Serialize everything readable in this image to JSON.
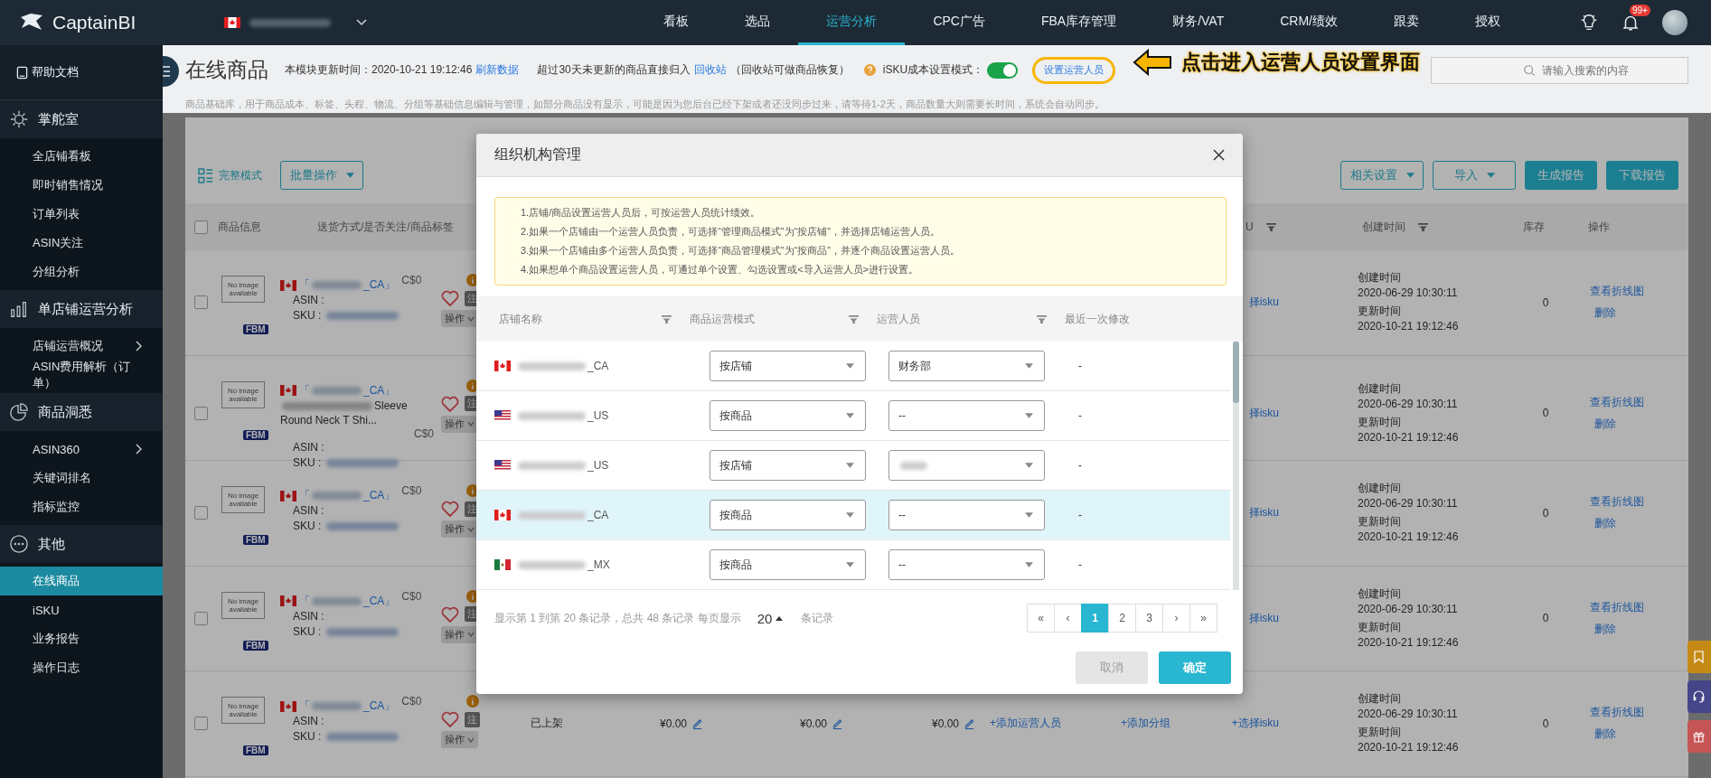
{
  "brand": {
    "name": "CaptainBI"
  },
  "nav": [
    {
      "label": "看板",
      "selected": false
    },
    {
      "label": "选品",
      "selected": false
    },
    {
      "label": "运营分析",
      "selected": true
    },
    {
      "label": "CPC广告",
      "selected": false
    },
    {
      "label": "FBA库存管理",
      "selected": false
    },
    {
      "label": "财务/VAT",
      "selected": false
    },
    {
      "label": "CRM/绩效",
      "selected": false
    },
    {
      "label": "跟卖",
      "selected": false
    },
    {
      "label": "授权",
      "selected": false
    }
  ],
  "notifications": {
    "badge": "99+"
  },
  "sidebar": {
    "help": "帮助文档",
    "sections": [
      {
        "label": "掌舵室",
        "items": [
          {
            "label": "全店铺看板",
            "selected": false,
            "expandable": false
          },
          {
            "label": "即时销售情况",
            "selected": false,
            "expandable": false
          },
          {
            "label": "订单列表",
            "selected": false,
            "expandable": false
          },
          {
            "label": "ASIN关注",
            "selected": false,
            "expandable": false
          },
          {
            "label": "分组分析",
            "selected": false,
            "expandable": false
          }
        ]
      },
      {
        "label": "单店铺运营分析",
        "items": [
          {
            "label": "店铺运营概况",
            "selected": false,
            "expandable": true
          },
          {
            "label": "ASIN费用解析（订单）",
            "selected": false,
            "expandable": false
          }
        ]
      },
      {
        "label": "商品洞悉",
        "items": [
          {
            "label": "ASIN360",
            "selected": false,
            "expandable": true
          },
          {
            "label": "关键词排名",
            "selected": false,
            "expandable": false
          },
          {
            "label": "指标监控",
            "selected": false,
            "expandable": false
          }
        ]
      },
      {
        "label": "其他",
        "items": [
          {
            "label": "在线商品",
            "selected": true,
            "expandable": false
          },
          {
            "label": "iSKU",
            "selected": false,
            "expandable": false
          },
          {
            "label": "业务报告",
            "selected": false,
            "expandable": false
          },
          {
            "label": "操作日志",
            "selected": false,
            "expandable": false
          }
        ]
      }
    ]
  },
  "page": {
    "title": "在线商品",
    "update_label": "本模块更新时间：2020-10-21 19:12:46",
    "refresh_link": "刷新数据",
    "recycle_note": "超过30天未更新的商品直接归入",
    "recycle_link": "回收站",
    "recycle_hint": "（回收站可做商品恢复）",
    "isku_mode_label": "iSKU成本设置模式：",
    "isku_mode_on": true,
    "operator_button": "设置运营人员",
    "operator_button_highlighted": true,
    "search_placeholder": "请输入搜索的内容",
    "description": "商品基础库，用于商品成本、标签、头程、物流、分组等基础信息编辑与管理，如部分商品没有显示，可能是因为您后台已经下架或者还没同步过来，请等待1-2天，商品数量大则需要长时间，系统会自动同步。"
  },
  "annotation": {
    "text": "点击进入运营人员设置界面"
  },
  "toolbar": {
    "view_mode": "完整模式",
    "batch": "批量操作",
    "right_buttons": [
      {
        "label": "相关设置",
        "kind": "dropdown"
      },
      {
        "label": "导入",
        "kind": "dropdown"
      },
      {
        "label": "生成报告",
        "kind": "primary"
      },
      {
        "label": "下载报告",
        "kind": "primary"
      }
    ]
  },
  "table": {
    "select_all_checked": false,
    "left_columns": [
      {
        "label": "商品信息"
      },
      {
        "label": "送货方式/是否关注/商品标签"
      }
    ],
    "right_columns": [
      {
        "label": "U"
      },
      {
        "label": "创建时间"
      },
      {
        "label": "库存"
      },
      {
        "label": "操作"
      }
    ],
    "rows": [
      {
        "checked": false,
        "image_text": "No image available",
        "kind": "ca",
        "store": [
          "「",
          "_CA」"
        ],
        "price": "C$0",
        "asin_label": "ASIN :",
        "sku_label": "SKU :",
        "fulfillment": "FBM",
        "favorite": false,
        "tag": "注",
        "menu": "操作",
        "isku": "择isku",
        "created_label": "创建时间",
        "created": "2020-06-29 10:30:11",
        "updated_label": "更新时间",
        "updated": "2020-10-21 19:12:46",
        "stock": "0",
        "actions": [
          "查看折线图",
          "删除"
        ]
      },
      {
        "checked": false,
        "image_text": "No image available",
        "kind": "ca",
        "store": [
          "「",
          "_CA」"
        ],
        "title": "Sleeve Round Neck T Shi...",
        "price": "C$0",
        "asin_label": "ASIN :",
        "sku_label": "SKU :",
        "fulfillment": "FBM",
        "favorite": false,
        "tag": "注",
        "menu": "操作",
        "isku": "择isku",
        "created_label": "创建时间",
        "created": "2020-06-29 10:30:11",
        "updated_label": "更新时间",
        "updated": "2020-10-21 19:12:46",
        "stock": "0",
        "actions": [
          "查看折线图",
          "删除"
        ]
      },
      {
        "checked": false,
        "image_text": "No image available",
        "kind": "ca",
        "store": [
          "「",
          "_CA」"
        ],
        "price": "C$0",
        "asin_label": "ASIN :",
        "sku_label": "SKU :",
        "fulfillment": "FBM",
        "favorite": false,
        "tag": "注",
        "menu": "操作",
        "isku": "择isku",
        "created_label": "创建时间",
        "created": "2020-06-29 10:30:11",
        "updated_label": "更新时间",
        "updated": "2020-10-21 19:12:46",
        "stock": "0",
        "actions": [
          "查看折线图",
          "删除"
        ]
      },
      {
        "checked": false,
        "image_text": "No image available",
        "kind": "ca",
        "store": [
          "「",
          "_CA」"
        ],
        "price": "C$0",
        "asin_label": "ASIN :",
        "sku_label": "SKU :",
        "fulfillment": "FBM",
        "favorite": false,
        "tag": "注",
        "menu": "操作",
        "isku": "择isku",
        "created_label": "创建时间",
        "created": "2020-06-29 10:30:11",
        "updated_label": "更新时间",
        "updated": "2020-10-21 19:12:46",
        "stock": "0",
        "actions": [
          "查看折线图",
          "删除"
        ]
      },
      {
        "checked": false,
        "image_text": "No image available",
        "kind": "ca",
        "store": [
          "「",
          "_CA」"
        ],
        "price": "C$0",
        "asin_label": "ASIN :",
        "sku_label": "SKU :",
        "fulfillment": "FBM",
        "favorite": false,
        "tag": "注",
        "menu": "操作",
        "status": "已上架",
        "prices": [
          "¥0.00",
          "¥0.00",
          "¥0.00"
        ],
        "operator_link": "+添加运营人员",
        "group_link": "+添加分组",
        "isku": "+选择isku",
        "created_label": "创建时间",
        "created": "2020-06-29 10:30:11",
        "updated_label": "更新时间",
        "updated": "2020-10-21 19:12:46",
        "stock": "0",
        "actions": [
          "查看折线图",
          "删除"
        ]
      }
    ]
  },
  "modal": {
    "title": "组织机构管理",
    "notes": [
      "1.店铺/商品设置运营人员后，可按运营人员统计绩效。",
      "2.如果一个店铺由一个运营人员负责，可选择“管理商品模式”为“按店铺”，并选择店铺运营人员。",
      "3.如果一个店铺由多个运营人员负责，可选择“商品管理模式”为“按商品”，并逐个商品设置运营人员。",
      "4.如果想单个商品设置运营人员，可通过单个设置、勾选设置或<导入运营人员>进行设置。"
    ],
    "columns": [
      {
        "label": "店铺名称"
      },
      {
        "label": "商品运营模式"
      },
      {
        "label": "运营人员"
      },
      {
        "label": "最近一次修改"
      }
    ],
    "rows": [
      {
        "kind": "ca",
        "store": "_CA",
        "mode": "按店铺",
        "operator_hidden": false,
        "operator": "财务部",
        "modified": "-",
        "selected": false
      },
      {
        "kind": "us",
        "store": "_US",
        "mode": "按商品",
        "operator_hidden": false,
        "operator": "--",
        "modified": "-",
        "selected": false
      },
      {
        "kind": "us",
        "store": "_US",
        "mode": "按店铺",
        "operator_hidden": true,
        "modified": "-",
        "selected": false
      },
      {
        "kind": "ca",
        "store": "_CA",
        "mode": "按商品",
        "operator_hidden": false,
        "operator": "--",
        "modified": "-",
        "selected": true
      },
      {
        "kind": "mx",
        "store": "_MX",
        "mode": "按商品",
        "operator_hidden": false,
        "operator": "--",
        "modified": "-",
        "selected": false
      }
    ],
    "pagination": {
      "summary": "显示第 1 到第 20 条记录，总共 48 条记录 每页显示",
      "page_size": "20",
      "page_size_suffix": "条记录",
      "pages": [
        {
          "label": "«",
          "selected": false
        },
        {
          "label": "‹",
          "selected": false
        },
        {
          "label": "1",
          "selected": true
        },
        {
          "label": "2",
          "selected": false
        },
        {
          "label": "3",
          "selected": false
        },
        {
          "label": "›",
          "selected": false
        },
        {
          "label": "»",
          "selected": false
        }
      ]
    },
    "buttons": [
      {
        "label": "取消",
        "kind": "cancel",
        "disabled": true
      },
      {
        "label": "确定",
        "kind": "primary",
        "disabled": false
      }
    ]
  }
}
